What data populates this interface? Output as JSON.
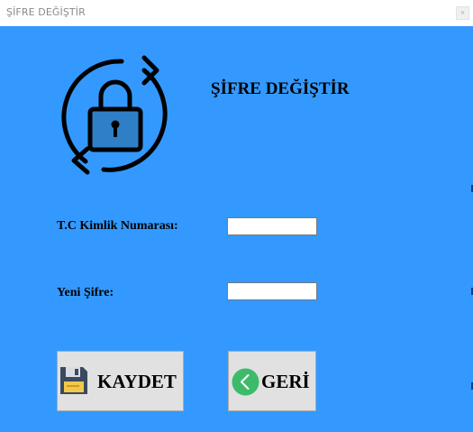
{
  "window": {
    "title": "ŞİFRE DEĞİŞTİR",
    "close_glyph": "×"
  },
  "form": {
    "heading": "ŞİFRE DEĞİŞTİR",
    "lock_icon": "lock-refresh-icon",
    "tc_label": "T.C Kimlik Numarası:",
    "tc_value": "",
    "password_label": "Yeni Şifre:",
    "password_value": ""
  },
  "buttons": {
    "save_label": "KAYDET",
    "save_icon": "floppy-disk-icon",
    "back_label": "GERİ",
    "back_icon": "chevron-left-circle-icon"
  },
  "colors": {
    "background": "#3399ff",
    "button": "#e1e1e1",
    "back_icon": "#3dbb6b"
  }
}
